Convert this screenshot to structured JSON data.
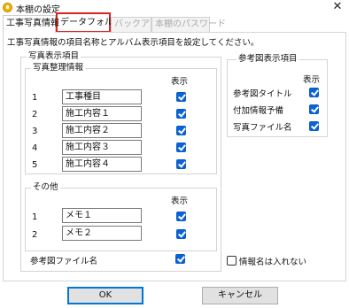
{
  "window": {
    "title": "本棚の設定",
    "close_glyph": "✕"
  },
  "tabs": [
    {
      "label": "工事写真情報"
    },
    {
      "label": "データフォルダ"
    },
    {
      "label": "バックアップ"
    },
    {
      "label": "本棚のパスワード"
    }
  ],
  "description": "工事写真情報の項目名称とアルバム表示項目を設定してください。",
  "photo_display": {
    "label": "写真表示項目",
    "organize": {
      "label": "写真整理情報",
      "display_header": "表示",
      "rows": [
        {
          "num": "1",
          "value": "工事種目",
          "display": true
        },
        {
          "num": "2",
          "value": "施工内容１",
          "display": true
        },
        {
          "num": "3",
          "value": "施工内容２",
          "display": true
        },
        {
          "num": "4",
          "value": "施工内容３",
          "display": true
        },
        {
          "num": "5",
          "value": "施工内容４",
          "display": true
        }
      ]
    },
    "other": {
      "label": "その他",
      "display_header": "表示",
      "rows": [
        {
          "num": "1",
          "value": "メモ１",
          "display": true
        },
        {
          "num": "2",
          "value": "メモ２",
          "display": true
        }
      ]
    },
    "ref_file": {
      "label": "参考図ファイル名",
      "checked": true
    }
  },
  "ref_display": {
    "label": "参考図表示項目",
    "display_header": "表示",
    "items": [
      {
        "label": "参考図タイトル",
        "checked": true
      },
      {
        "label": "付加情報予備",
        "checked": true
      },
      {
        "label": "写真ファイル名",
        "checked": true
      }
    ]
  },
  "no_info_name": {
    "label": "情報名は入れない",
    "checked": false
  },
  "buttons": {
    "ok": "OK",
    "cancel": "キャンセル"
  },
  "colors": {
    "accent": "#0a64d8",
    "highlight": "#e02020"
  }
}
